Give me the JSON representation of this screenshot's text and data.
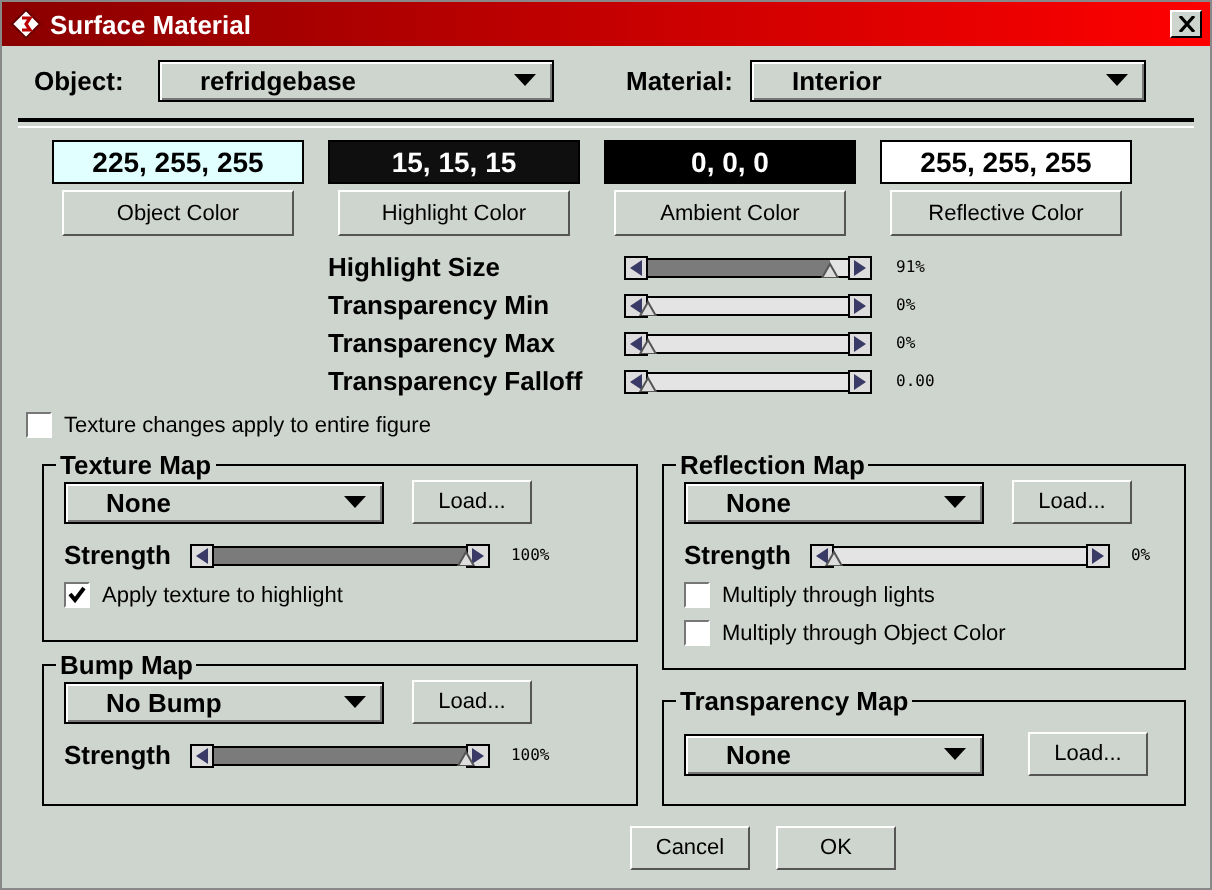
{
  "window": {
    "title": "Surface Material"
  },
  "object": {
    "label": "Object:",
    "value": "refridgebase"
  },
  "material": {
    "label": "Material:",
    "value": "Interior"
  },
  "colors": [
    {
      "value": "225, 255, 255",
      "color": "#e1ffff",
      "button": "Object Color"
    },
    {
      "value": "15, 15, 15",
      "color": "#0f0f0f",
      "button": "Highlight Color"
    },
    {
      "value": "0, 0, 0",
      "color": "#000000",
      "button": "Ambient Color"
    },
    {
      "value": "255, 255, 255",
      "color": "#ffffff",
      "button": "Reflective Color"
    }
  ],
  "sliders": [
    {
      "label": "Highlight Size",
      "level": 0.91,
      "reading": "91%"
    },
    {
      "label": "Transparency Min",
      "level": 0,
      "reading": "0%"
    },
    {
      "label": "Transparency Max",
      "level": 0,
      "reading": "0%"
    },
    {
      "label": "Transparency Falloff",
      "level": 0,
      "reading": "0.00"
    }
  ],
  "entire_figure": {
    "label": "Texture changes apply to entire figure",
    "checked": false
  },
  "texture_map": {
    "title": "Texture Map",
    "dropdown": "None",
    "load": "Load...",
    "strength": {
      "label": "Strength",
      "level": 1,
      "reading": "100%"
    },
    "options": [
      {
        "label": "Apply texture to highlight",
        "checked": true
      }
    ]
  },
  "bump_map": {
    "title": "Bump Map",
    "dropdown": "No Bump",
    "load": "Load...",
    "strength": {
      "label": "Strength",
      "level": 1,
      "reading": "100%"
    }
  },
  "reflection_map": {
    "title": "Reflection Map",
    "dropdown": "None",
    "load": "Load...",
    "strength": {
      "label": "Strength",
      "level": 0,
      "reading": "0%"
    },
    "options": [
      {
        "label": "Multiply through lights",
        "checked": false
      },
      {
        "label": "Multiply through Object Color",
        "checked": false
      }
    ]
  },
  "transparency_map": {
    "title": "Transparency Map",
    "dropdown": "None",
    "load": "Load..."
  },
  "buttons": [
    "Cancel",
    "OK"
  ]
}
